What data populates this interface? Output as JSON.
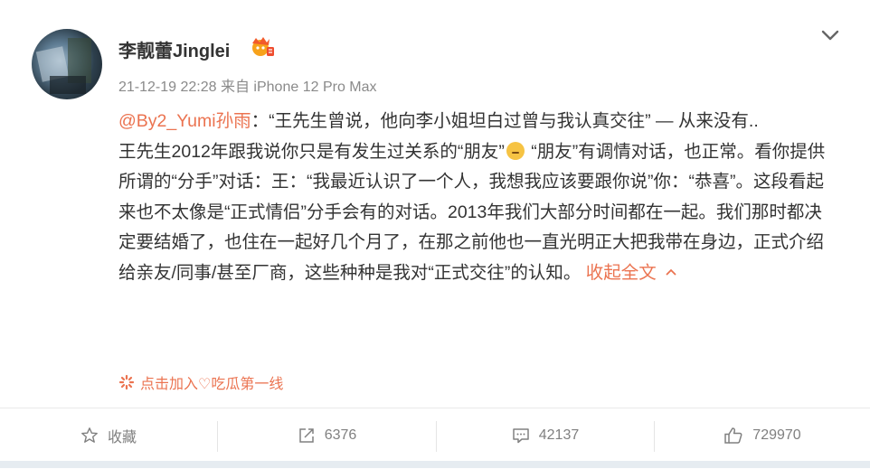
{
  "post": {
    "author_name": "李靓蕾Jinglei",
    "timestamp": "21-12-19 22:28",
    "source": "来自 iPhone 12 Pro Max",
    "mention": "@By2_Yumi孙雨",
    "line1": "：“王先生曾说，他向李小姐坦白过曾与我认真交往” — 从来没有..",
    "para_a": "王先生2012年跟我说你只是有发生过关系的“朋友”",
    "para_b": " “朋友”有调情对话，也正常。看你提供所谓的“分手”对话：王：“我最近认识了一个人，我想我应该要跟你说”你：“恭喜”。这段看起来也不太像是“正式情侣”分手会有的对话。2013年我们大部分时间都在一起。我们那时都决定要结婚了，也住在一起好几个月了，在那之前他也一直光明正大把我带在身边，正式介绍给亲友/同事/甚至厂商，这些种种是我对“正式交往”的认知。",
    "collapse_label": "收起全文",
    "promo_label": "点击加入♡吃瓜第一线"
  },
  "actions": {
    "favorite_label": "收藏",
    "repost_count": "6376",
    "comment_count": "42137",
    "like_count": "729970"
  },
  "colors": {
    "accent": "#eb7350",
    "meta_gray": "#8a8a8a",
    "text": "#333333"
  },
  "icons": [
    "more-chevron-icon",
    "member-badge-icon",
    "thinking-emoji-icon",
    "chevron-up-icon",
    "promo-flower-icon",
    "star-icon",
    "repost-icon",
    "comment-icon",
    "like-icon"
  ]
}
